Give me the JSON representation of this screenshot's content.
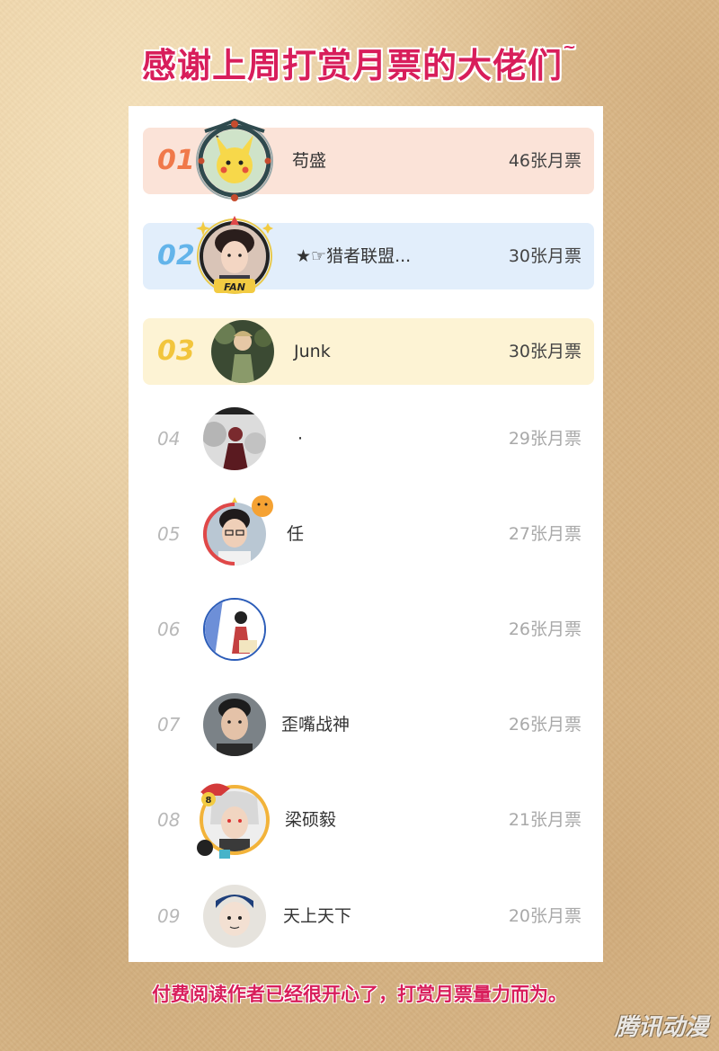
{
  "title": "感谢上周打赏月票的大佬们",
  "title_suffix": "~",
  "footer": "付费阅读作者已经很开心了，打赏月票量力而为。",
  "watermark": "腾讯动漫",
  "colors": {
    "title": "#d81e5b",
    "rank1": "#f0794a",
    "rank2": "#63b4ea",
    "rank3": "#f2c53c",
    "row1_bg": "#fbe3d8",
    "row2_bg": "#e2eefb",
    "row3_bg": "#fdf3d4"
  },
  "leaderboard": [
    {
      "rank": "01",
      "name": "苟盛",
      "votes": "46张月票",
      "avatar_icon": "pikachu-avatar-icon"
    },
    {
      "rank": "02",
      "name": "★☞猎者联盟...",
      "votes": "30张月票",
      "avatar_icon": "person-avatar-icon"
    },
    {
      "rank": "03",
      "name": "Junk",
      "votes": "30张月票",
      "avatar_icon": "character-avatar-icon"
    },
    {
      "rank": "04",
      "name": "·",
      "votes": "29张月票",
      "avatar_icon": "figure-avatar-icon"
    },
    {
      "rank": "05",
      "name": "任",
      "votes": "27张月票",
      "avatar_icon": "person-avatar-icon"
    },
    {
      "rank": "06",
      "name": "",
      "votes": "26张月票",
      "avatar_icon": "illustration-avatar-icon"
    },
    {
      "rank": "07",
      "name": "歪嘴战神",
      "votes": "26张月票",
      "avatar_icon": "person-avatar-icon"
    },
    {
      "rank": "08",
      "name": "梁硕毅",
      "votes": "21张月票",
      "avatar_icon": "anime-avatar-icon"
    },
    {
      "rank": "09",
      "name": "天上天下",
      "votes": "20张月票",
      "avatar_icon": "cartoon-avatar-icon"
    }
  ]
}
